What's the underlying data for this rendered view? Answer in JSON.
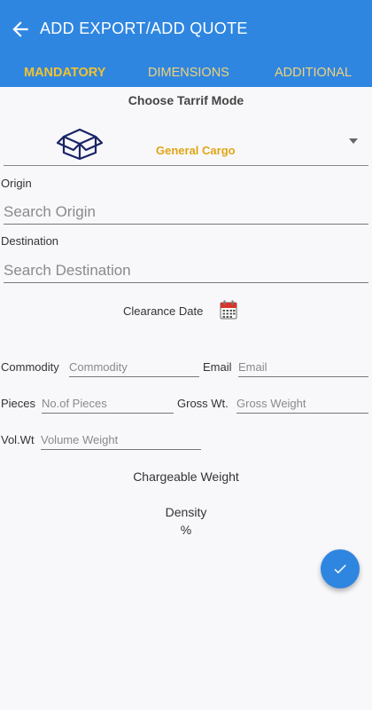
{
  "header": {
    "title": "ADD EXPORT/ADD QUOTE"
  },
  "tabs": [
    {
      "label": "MANDATORY",
      "active": true
    },
    {
      "label": "DIMENSIONS",
      "active": false
    },
    {
      "label": "ADDITIONAL",
      "active": false
    }
  ],
  "tarrif": {
    "label": "Choose Tarrif Mode",
    "value": "General Cargo"
  },
  "origin": {
    "label": "Origin",
    "placeholder": "Search Origin"
  },
  "destination": {
    "label": "Destination",
    "placeholder": "Search Destination"
  },
  "clearance": {
    "label": "Clearance Date"
  },
  "commodity": {
    "label": "Commodity",
    "placeholder": "Commodity"
  },
  "email": {
    "label": "Email",
    "placeholder": "Email"
  },
  "pieces": {
    "label": "Pieces",
    "placeholder": "No.of Pieces"
  },
  "gross": {
    "label": "Gross Wt.",
    "placeholder": "Gross Weight"
  },
  "volume": {
    "label": "Vol.Wt",
    "placeholder": "Volume Weight"
  },
  "chargeable": {
    "label": "Chargeable Weight"
  },
  "density": {
    "label": "Density",
    "unit": "%"
  },
  "colors": {
    "primary": "#2f86e0",
    "accent": "#f2c230",
    "mode_value": "#e0a515"
  },
  "icons": {
    "back": "arrow-left-icon",
    "box": "box-icon",
    "calendar": "calendar-icon",
    "submit": "check-icon"
  }
}
